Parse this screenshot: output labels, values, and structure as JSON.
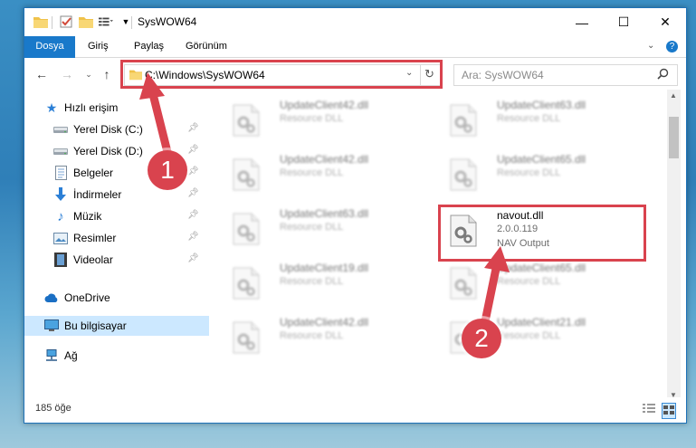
{
  "window": {
    "title": "SysWOW64",
    "controls": {
      "minimize": "—",
      "maximize": "☐",
      "close": "✕"
    }
  },
  "ribbon": {
    "tabs": [
      "Dosya",
      "Giriş",
      "Paylaş",
      "Görünüm"
    ]
  },
  "address": {
    "path": "C:\\Windows\\SysWOW64",
    "search_placeholder": "Ara: SysWOW64"
  },
  "nav": {
    "quick_access": "Hızlı erişim",
    "items": [
      {
        "label": "Yerel Disk (C:)",
        "icon": "drive-icon",
        "pinned": true
      },
      {
        "label": "Yerel Disk (D:)",
        "icon": "drive-icon",
        "pinned": true
      },
      {
        "label": "Belgeler",
        "icon": "documents-icon",
        "pinned": true
      },
      {
        "label": "İndirmeler",
        "icon": "download-icon",
        "pinned": true
      },
      {
        "label": "Müzik",
        "icon": "music-icon",
        "pinned": true
      },
      {
        "label": "Resimler",
        "icon": "pictures-icon",
        "pinned": true
      },
      {
        "label": "Videolar",
        "icon": "videos-icon",
        "pinned": true
      }
    ],
    "onedrive": "OneDrive",
    "this_pc": "Bu bilgisayar",
    "network": "Ağ"
  },
  "files": {
    "left_column": [
      {
        "name": "UpdateClient42.dll",
        "type": "Resource DLL"
      },
      {
        "name": "UpdateClient42.dll",
        "type": "Resource DLL"
      },
      {
        "name": "UpdateClient63.dll",
        "type": "Resource DLL"
      },
      {
        "name": "UpdateClient19.dll",
        "type": "Resource DLL"
      },
      {
        "name": "UpdateClient42.dll",
        "type": "Resource DLL"
      }
    ],
    "right_column": [
      {
        "name": "UpdateClient63.dll",
        "type": "Resource DLL"
      },
      {
        "name": "UpdateClient65.dll",
        "type": "Resource DLL"
      },
      {
        "name": "UpdateClient65.dll",
        "type": "Resource DLL"
      },
      {
        "name": "UpdateClient21.dll",
        "type": "Resource DLL"
      }
    ],
    "selected": {
      "name": "navout.dll",
      "version": "2.0.0.119",
      "description": "NAV Output"
    }
  },
  "status": {
    "count": "185 öğe"
  },
  "annotations": {
    "badge1": "1",
    "badge2": "2"
  },
  "colors": {
    "accent": "#1979ca",
    "annotation": "#d9434e",
    "selection": "#cce8ff"
  }
}
